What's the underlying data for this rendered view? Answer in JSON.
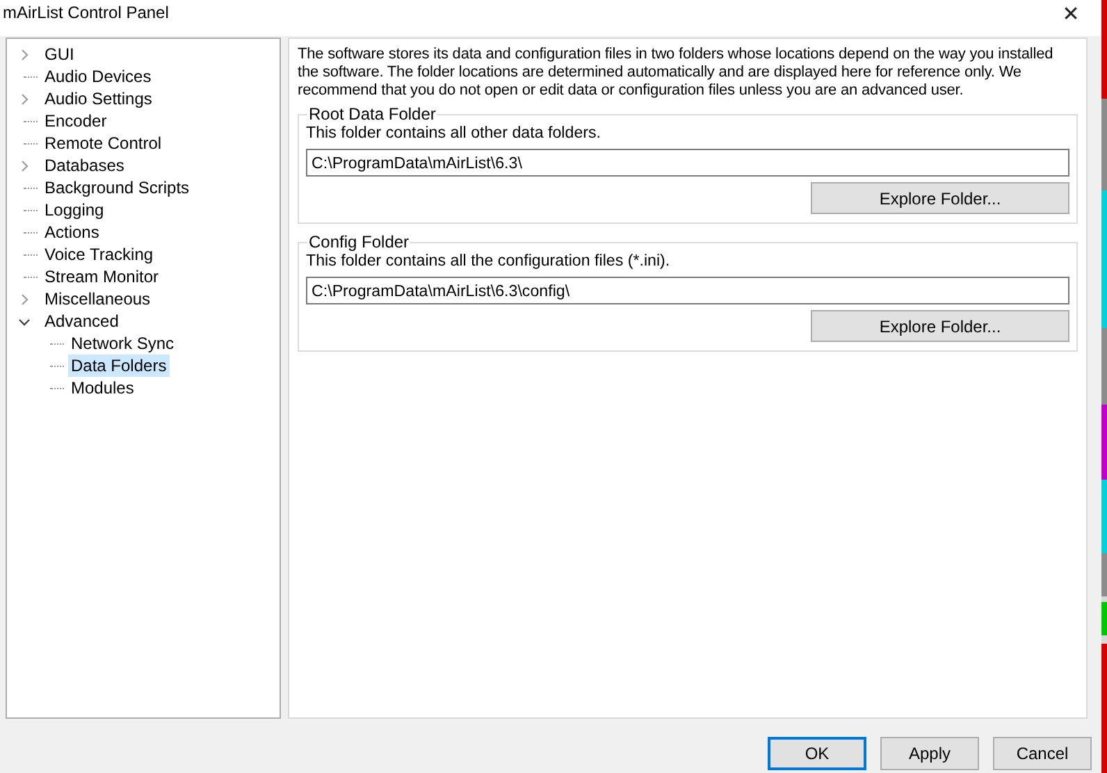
{
  "window": {
    "title": "mAirList Control Panel",
    "close": "✕"
  },
  "tree": [
    {
      "label": "GUI",
      "expanded": false,
      "selected": false
    },
    {
      "label": "Audio Devices",
      "selected": false
    },
    {
      "label": "Audio Settings",
      "expanded": false,
      "selected": false
    },
    {
      "label": "Encoder",
      "selected": false
    },
    {
      "label": "Remote Control",
      "selected": false
    },
    {
      "label": "Databases",
      "expanded": false,
      "selected": false
    },
    {
      "label": "Background Scripts",
      "selected": false
    },
    {
      "label": "Logging",
      "selected": false
    },
    {
      "label": "Actions",
      "selected": false
    },
    {
      "label": "Voice Tracking",
      "selected": false
    },
    {
      "label": "Stream Monitor",
      "selected": false
    },
    {
      "label": "Miscellaneous",
      "expanded": false,
      "selected": false
    },
    {
      "label": "Advanced",
      "expanded": true,
      "selected": false,
      "children": [
        {
          "label": "Network Sync",
          "selected": false
        },
        {
          "label": "Data Folders",
          "selected": true
        },
        {
          "label": "Modules",
          "selected": false
        }
      ]
    }
  ],
  "intro": "The software stores its data and configuration files in two folders whose locations depend on the way you installed the software. The folder locations are determined automatically and are displayed here for reference only. We recommend that you do not open or edit data or configuration files unless you are an advanced user.",
  "groups": [
    {
      "title": "Root Data Folder",
      "description": "This folder contains all other data folders.",
      "value": "C:\\ProgramData\\mAirList\\6.3\\",
      "button": "Explore Folder..."
    },
    {
      "title": "Config Folder",
      "description": "This folder contains all the configuration files (*.ini).",
      "value": "C:\\ProgramData\\mAirList\\6.3\\config\\",
      "button": "Explore Folder..."
    }
  ],
  "buttons": [
    {
      "label": "OK",
      "default": true
    },
    {
      "label": "Apply",
      "default": false
    },
    {
      "label": "Cancel",
      "default": false
    }
  ]
}
